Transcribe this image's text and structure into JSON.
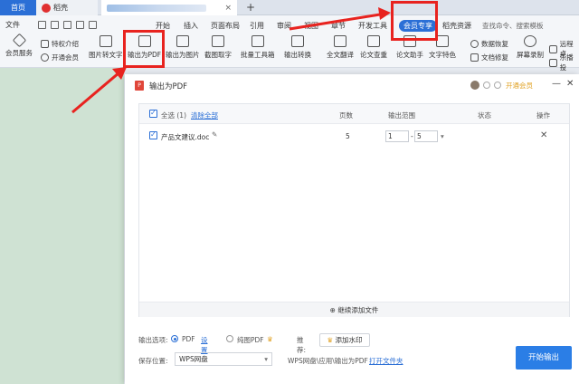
{
  "tabs": {
    "home": "首页",
    "second": "稻壳",
    "plus": "+"
  },
  "menu": {
    "file": "文件",
    "items": [
      "开始",
      "插入",
      "页面布局",
      "引用",
      "审阅",
      "视图",
      "章节",
      "开发工具"
    ],
    "vip": "会员专享",
    "resources": "稻壳资源",
    "search": "查找命令、搜索模板"
  },
  "toolbar": {
    "member_service": "会员服务",
    "privilege_intro": "特权介绍",
    "open_member": "开通会员",
    "image_to_text": "图片转文字",
    "export_pdf": "输出为PDF",
    "export_image": "输出为图片",
    "screenshot_ocr": "截图取字",
    "batch_tools": "批量工具箱",
    "export_convert": "输出转换",
    "full_translate": "全文翻译",
    "paper_check": "论文查重",
    "paper_assist": "论文助手",
    "text_style": "文字特色",
    "data_recover": "数据恢复",
    "doc_repair": "文档修复",
    "screen_record": "屏幕录制",
    "remote_assist": "远程桌",
    "music_play": "乐播投"
  },
  "dialog": {
    "title": "输出为PDF",
    "vip_link": "开通会员",
    "headers": {
      "select_all": "全选 (1)",
      "clear_all": "清除全部",
      "pages": "页数",
      "range": "输出范围",
      "status": "状态",
      "action": "操作"
    },
    "rows": [
      {
        "name": "产品文建议.doc",
        "pages": "5",
        "from": "1",
        "to": "5",
        "sep": "-"
      }
    ],
    "add_file": "继续添加文件",
    "output_option_label": "输出选项:",
    "opt_pdf": "PDF",
    "settings": "设置",
    "opt_image_pdf": "纯图PDF",
    "recommend_label": "推荐:",
    "add_watermark": "添加水印",
    "save_label": "保存位置:",
    "save_value": "WPS网盘",
    "save_path": "WPS网盘\\应用\\输出为PDF",
    "open_folder": "打开文件夹",
    "start": "开始输出"
  },
  "colors": {
    "accent": "#2b6fd6",
    "annotation": "#e8231f",
    "vip": "#e0a020"
  }
}
